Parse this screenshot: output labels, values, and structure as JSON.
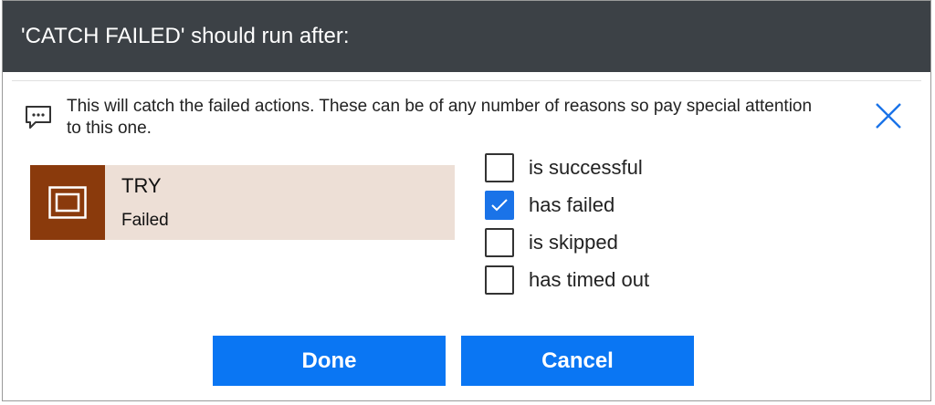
{
  "dialog": {
    "title": "'CATCH FAILED' should run after:",
    "info_text": "This will catch the failed actions. These can be of any number of reasons so pay special attention to this one.",
    "icons": {
      "info": "comment-icon",
      "close": "close-icon",
      "action": "scope-icon"
    }
  },
  "action": {
    "title": "TRY",
    "status": "Failed",
    "accent_color": "#8a3a0c",
    "card_color": "#eddfd6"
  },
  "conditions": [
    {
      "label": "is successful",
      "checked": false
    },
    {
      "label": "has failed",
      "checked": true
    },
    {
      "label": "is skipped",
      "checked": false
    },
    {
      "label": "has timed out",
      "checked": false
    }
  ],
  "buttons": {
    "done_label": "Done",
    "cancel_label": "Cancel",
    "color": "#0a76f3"
  },
  "colors": {
    "header": "#3c4146",
    "checkbox_checked": "#1a73e8"
  }
}
